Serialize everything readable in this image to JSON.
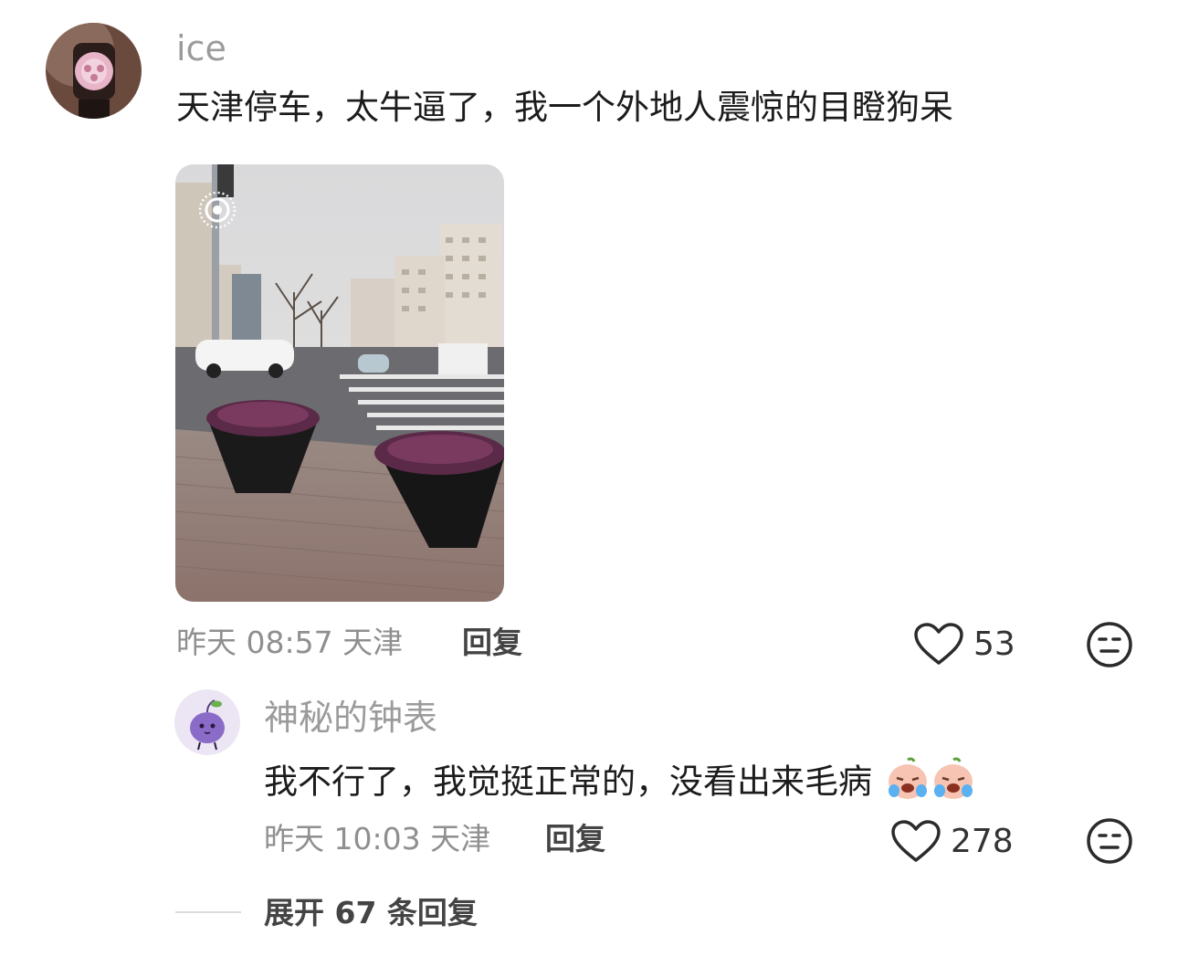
{
  "comment": {
    "username": "ice",
    "text": "天津停车，太牛逼了，我一个外地人震惊的目瞪狗呆",
    "time": "昨天 08:57",
    "location": "天津",
    "reply_label": "回复",
    "likes": "53"
  },
  "reply": {
    "username": "神秘的钟表",
    "text": "我不行了，我觉挺正常的，没看出来毛病",
    "time": "昨天 10:03",
    "location": "天津",
    "reply_label": "回复",
    "likes": "278"
  },
  "expand_label": "展开 67 条回复",
  "icons": {
    "like": "heart-outline-icon",
    "dislike": "meh-face-icon",
    "live_photo": "live-photo-icon",
    "emoji": "crying-face-emoji"
  }
}
